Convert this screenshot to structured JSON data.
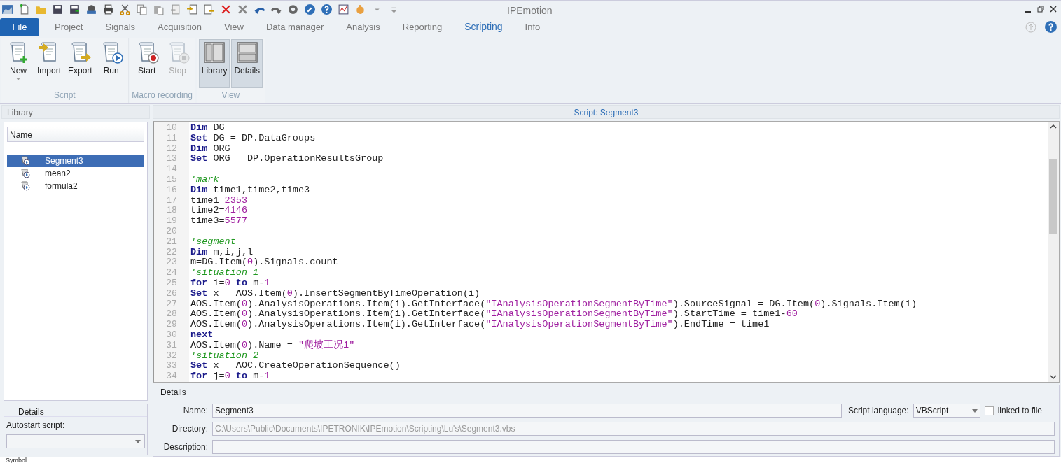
{
  "window": {
    "title": "IPEmotion"
  },
  "tabs": [
    {
      "label": "File",
      "kind": "file",
      "selected": false
    },
    {
      "label": "Project",
      "kind": "tab",
      "selected": false
    },
    {
      "label": "Signals",
      "kind": "tab",
      "selected": false
    },
    {
      "label": "Acquisition",
      "kind": "tab",
      "selected": false
    },
    {
      "label": "View",
      "kind": "tab",
      "selected": false
    },
    {
      "label": "Data manager",
      "kind": "tab",
      "selected": false
    },
    {
      "label": "Analysis",
      "kind": "tab",
      "selected": false
    },
    {
      "label": "Reporting",
      "kind": "tab",
      "selected": false
    },
    {
      "label": "Scripting",
      "kind": "tab",
      "selected": true
    },
    {
      "label": "Info",
      "kind": "tab",
      "selected": false
    }
  ],
  "ribbon": [
    {
      "group": "Script",
      "buttons": [
        {
          "label": "New",
          "kind": "new",
          "dropdown": true,
          "disabled": false,
          "selected": false
        },
        {
          "label": "Import",
          "kind": "import",
          "dropdown": false,
          "disabled": false,
          "selected": false
        },
        {
          "label": "Export",
          "kind": "export",
          "dropdown": false,
          "disabled": false,
          "selected": false
        },
        {
          "label": "Run",
          "kind": "run",
          "dropdown": false,
          "disabled": false,
          "selected": false
        }
      ]
    },
    {
      "group": "Macro recording",
      "buttons": [
        {
          "label": "Start",
          "kind": "record",
          "dropdown": false,
          "disabled": false,
          "selected": false
        },
        {
          "label": "Stop",
          "kind": "stop",
          "dropdown": false,
          "disabled": true,
          "selected": false
        }
      ]
    },
    {
      "group": "View",
      "buttons": [
        {
          "label": "Library",
          "kind": "library",
          "dropdown": false,
          "disabled": false,
          "selected": true
        },
        {
          "label": "Details",
          "kind": "details",
          "dropdown": false,
          "disabled": false,
          "selected": true
        }
      ]
    }
  ],
  "library": {
    "title": "Library",
    "column": "Name",
    "items": [
      {
        "name": "Segment3",
        "selected": true
      },
      {
        "name": "mean2",
        "selected": false
      },
      {
        "name": "formula2",
        "selected": false
      }
    ],
    "details": {
      "title": "Details",
      "autostart_label": "Autostart script:"
    }
  },
  "editor": {
    "title": "Script: Segment3",
    "lines": [
      {
        "number": "10",
        "tokens": [
          {
            "kind": "kw",
            "text": "Dim"
          },
          {
            "kind": "plain",
            "text": " DG"
          }
        ]
      },
      {
        "number": "11",
        "tokens": [
          {
            "kind": "kw",
            "text": "Set"
          },
          {
            "kind": "plain",
            "text": " DG = DP.DataGroups"
          }
        ]
      },
      {
        "number": "12",
        "tokens": [
          {
            "kind": "kw",
            "text": "Dim"
          },
          {
            "kind": "plain",
            "text": " ORG"
          }
        ]
      },
      {
        "number": "13",
        "tokens": [
          {
            "kind": "kw",
            "text": "Set"
          },
          {
            "kind": "plain",
            "text": " ORG = DP.OperationResultsGroup"
          }
        ]
      },
      {
        "number": "14"
      },
      {
        "number": "15",
        "tokens": [
          {
            "kind": "comment",
            "text": "'mark"
          }
        ]
      },
      {
        "number": "16",
        "tokens": [
          {
            "kind": "kw",
            "text": "Dim"
          },
          {
            "kind": "plain",
            "text": " time1,time2,time3"
          }
        ]
      },
      {
        "number": "17",
        "tokens": [
          {
            "kind": "plain",
            "text": "time1="
          },
          {
            "kind": "num",
            "text": "2353"
          }
        ]
      },
      {
        "number": "18",
        "tokens": [
          {
            "kind": "plain",
            "text": "time2="
          },
          {
            "kind": "num",
            "text": "4146"
          }
        ]
      },
      {
        "number": "19",
        "tokens": [
          {
            "kind": "plain",
            "text": "time3="
          },
          {
            "kind": "num",
            "text": "5577"
          }
        ]
      },
      {
        "number": "20"
      },
      {
        "number": "21",
        "tokens": [
          {
            "kind": "comment",
            "text": "'segment"
          }
        ]
      },
      {
        "number": "22",
        "tokens": [
          {
            "kind": "kw",
            "text": "Dim"
          },
          {
            "kind": "plain",
            "text": " m,i,j,l"
          }
        ]
      },
      {
        "number": "23",
        "tokens": [
          {
            "kind": "plain",
            "text": "m=DG.Item("
          },
          {
            "kind": "num",
            "text": "0"
          },
          {
            "kind": "plain",
            "text": ").Signals.count"
          }
        ]
      },
      {
        "number": "24",
        "tokens": [
          {
            "kind": "comment",
            "text": "'situation 1"
          }
        ]
      },
      {
        "number": "25",
        "tokens": [
          {
            "kind": "kw",
            "text": "for"
          },
          {
            "kind": "plain",
            "text": " i="
          },
          {
            "kind": "num",
            "text": "0"
          },
          {
            "kind": "kw",
            "text": " to"
          },
          {
            "kind": "plain",
            "text": " m-"
          },
          {
            "kind": "num",
            "text": "1"
          }
        ]
      },
      {
        "number": "26",
        "tokens": [
          {
            "kind": "kw",
            "text": "Set"
          },
          {
            "kind": "plain",
            "text": " x = AOS.Item("
          },
          {
            "kind": "num",
            "text": "0"
          },
          {
            "kind": "plain",
            "text": ").InsertSegmentByTimeOperation(i)"
          }
        ]
      },
      {
        "number": "27",
        "tokens": [
          {
            "kind": "plain",
            "text": "AOS.Item("
          },
          {
            "kind": "num",
            "text": "0"
          },
          {
            "kind": "plain",
            "text": ").AnalysisOperations.Item(i).GetInterface("
          },
          {
            "kind": "str",
            "text": "\"IAnalysisOperationSegmentByTime\""
          },
          {
            "kind": "plain",
            "text": ").SourceSignal = DG.Item("
          },
          {
            "kind": "num",
            "text": "0"
          },
          {
            "kind": "plain",
            "text": ").Signals.Item(i)"
          }
        ]
      },
      {
        "number": "28",
        "tokens": [
          {
            "kind": "plain",
            "text": "AOS.Item("
          },
          {
            "kind": "num",
            "text": "0"
          },
          {
            "kind": "plain",
            "text": ").AnalysisOperations.Item(i).GetInterface("
          },
          {
            "kind": "str",
            "text": "\"IAnalysisOperationSegmentByTime\""
          },
          {
            "kind": "plain",
            "text": ").StartTime = time1-"
          },
          {
            "kind": "num",
            "text": "60"
          }
        ]
      },
      {
        "number": "29",
        "tokens": [
          {
            "kind": "plain",
            "text": "AOS.Item("
          },
          {
            "kind": "num",
            "text": "0"
          },
          {
            "kind": "plain",
            "text": ").AnalysisOperations.Item(i).GetInterface("
          },
          {
            "kind": "str",
            "text": "\"IAnalysisOperationSegmentByTime\""
          },
          {
            "kind": "plain",
            "text": ").EndTime = time1"
          }
        ]
      },
      {
        "number": "30",
        "tokens": [
          {
            "kind": "kw",
            "text": "next"
          }
        ]
      },
      {
        "number": "31",
        "tokens": [
          {
            "kind": "plain",
            "text": "AOS.Item("
          },
          {
            "kind": "num",
            "text": "0"
          },
          {
            "kind": "plain",
            "text": ").Name = "
          },
          {
            "kind": "str",
            "text": "\"爬坡工况1\""
          }
        ]
      },
      {
        "number": "32",
        "tokens": [
          {
            "kind": "comment",
            "text": "'situation 2"
          }
        ]
      },
      {
        "number": "33",
        "tokens": [
          {
            "kind": "kw",
            "text": "Set"
          },
          {
            "kind": "plain",
            "text": " x = AOC.CreateOperationSequence()"
          }
        ]
      },
      {
        "number": "34",
        "tokens": [
          {
            "kind": "kw",
            "text": "for"
          },
          {
            "kind": "plain",
            "text": " j="
          },
          {
            "kind": "num",
            "text": "0"
          },
          {
            "kind": "kw",
            "text": " to"
          },
          {
            "kind": "plain",
            "text": " m-"
          },
          {
            "kind": "num",
            "text": "1"
          }
        ]
      }
    ]
  },
  "details": {
    "title": "Details",
    "name_label": "Name:",
    "name_value": "Segment3",
    "language_label": "Script language:",
    "language_value": "VBScript",
    "linked_label": "linked to file",
    "linked_checked": false,
    "directory_label": "Directory:",
    "directory_value": "C:\\Users\\Public\\Documents\\IPETRONIK\\IPEmotion\\Scripting\\Lu's\\Segment3.vbs",
    "description_label": "Description:"
  },
  "status_bar": {
    "text": "Symbol"
  }
}
